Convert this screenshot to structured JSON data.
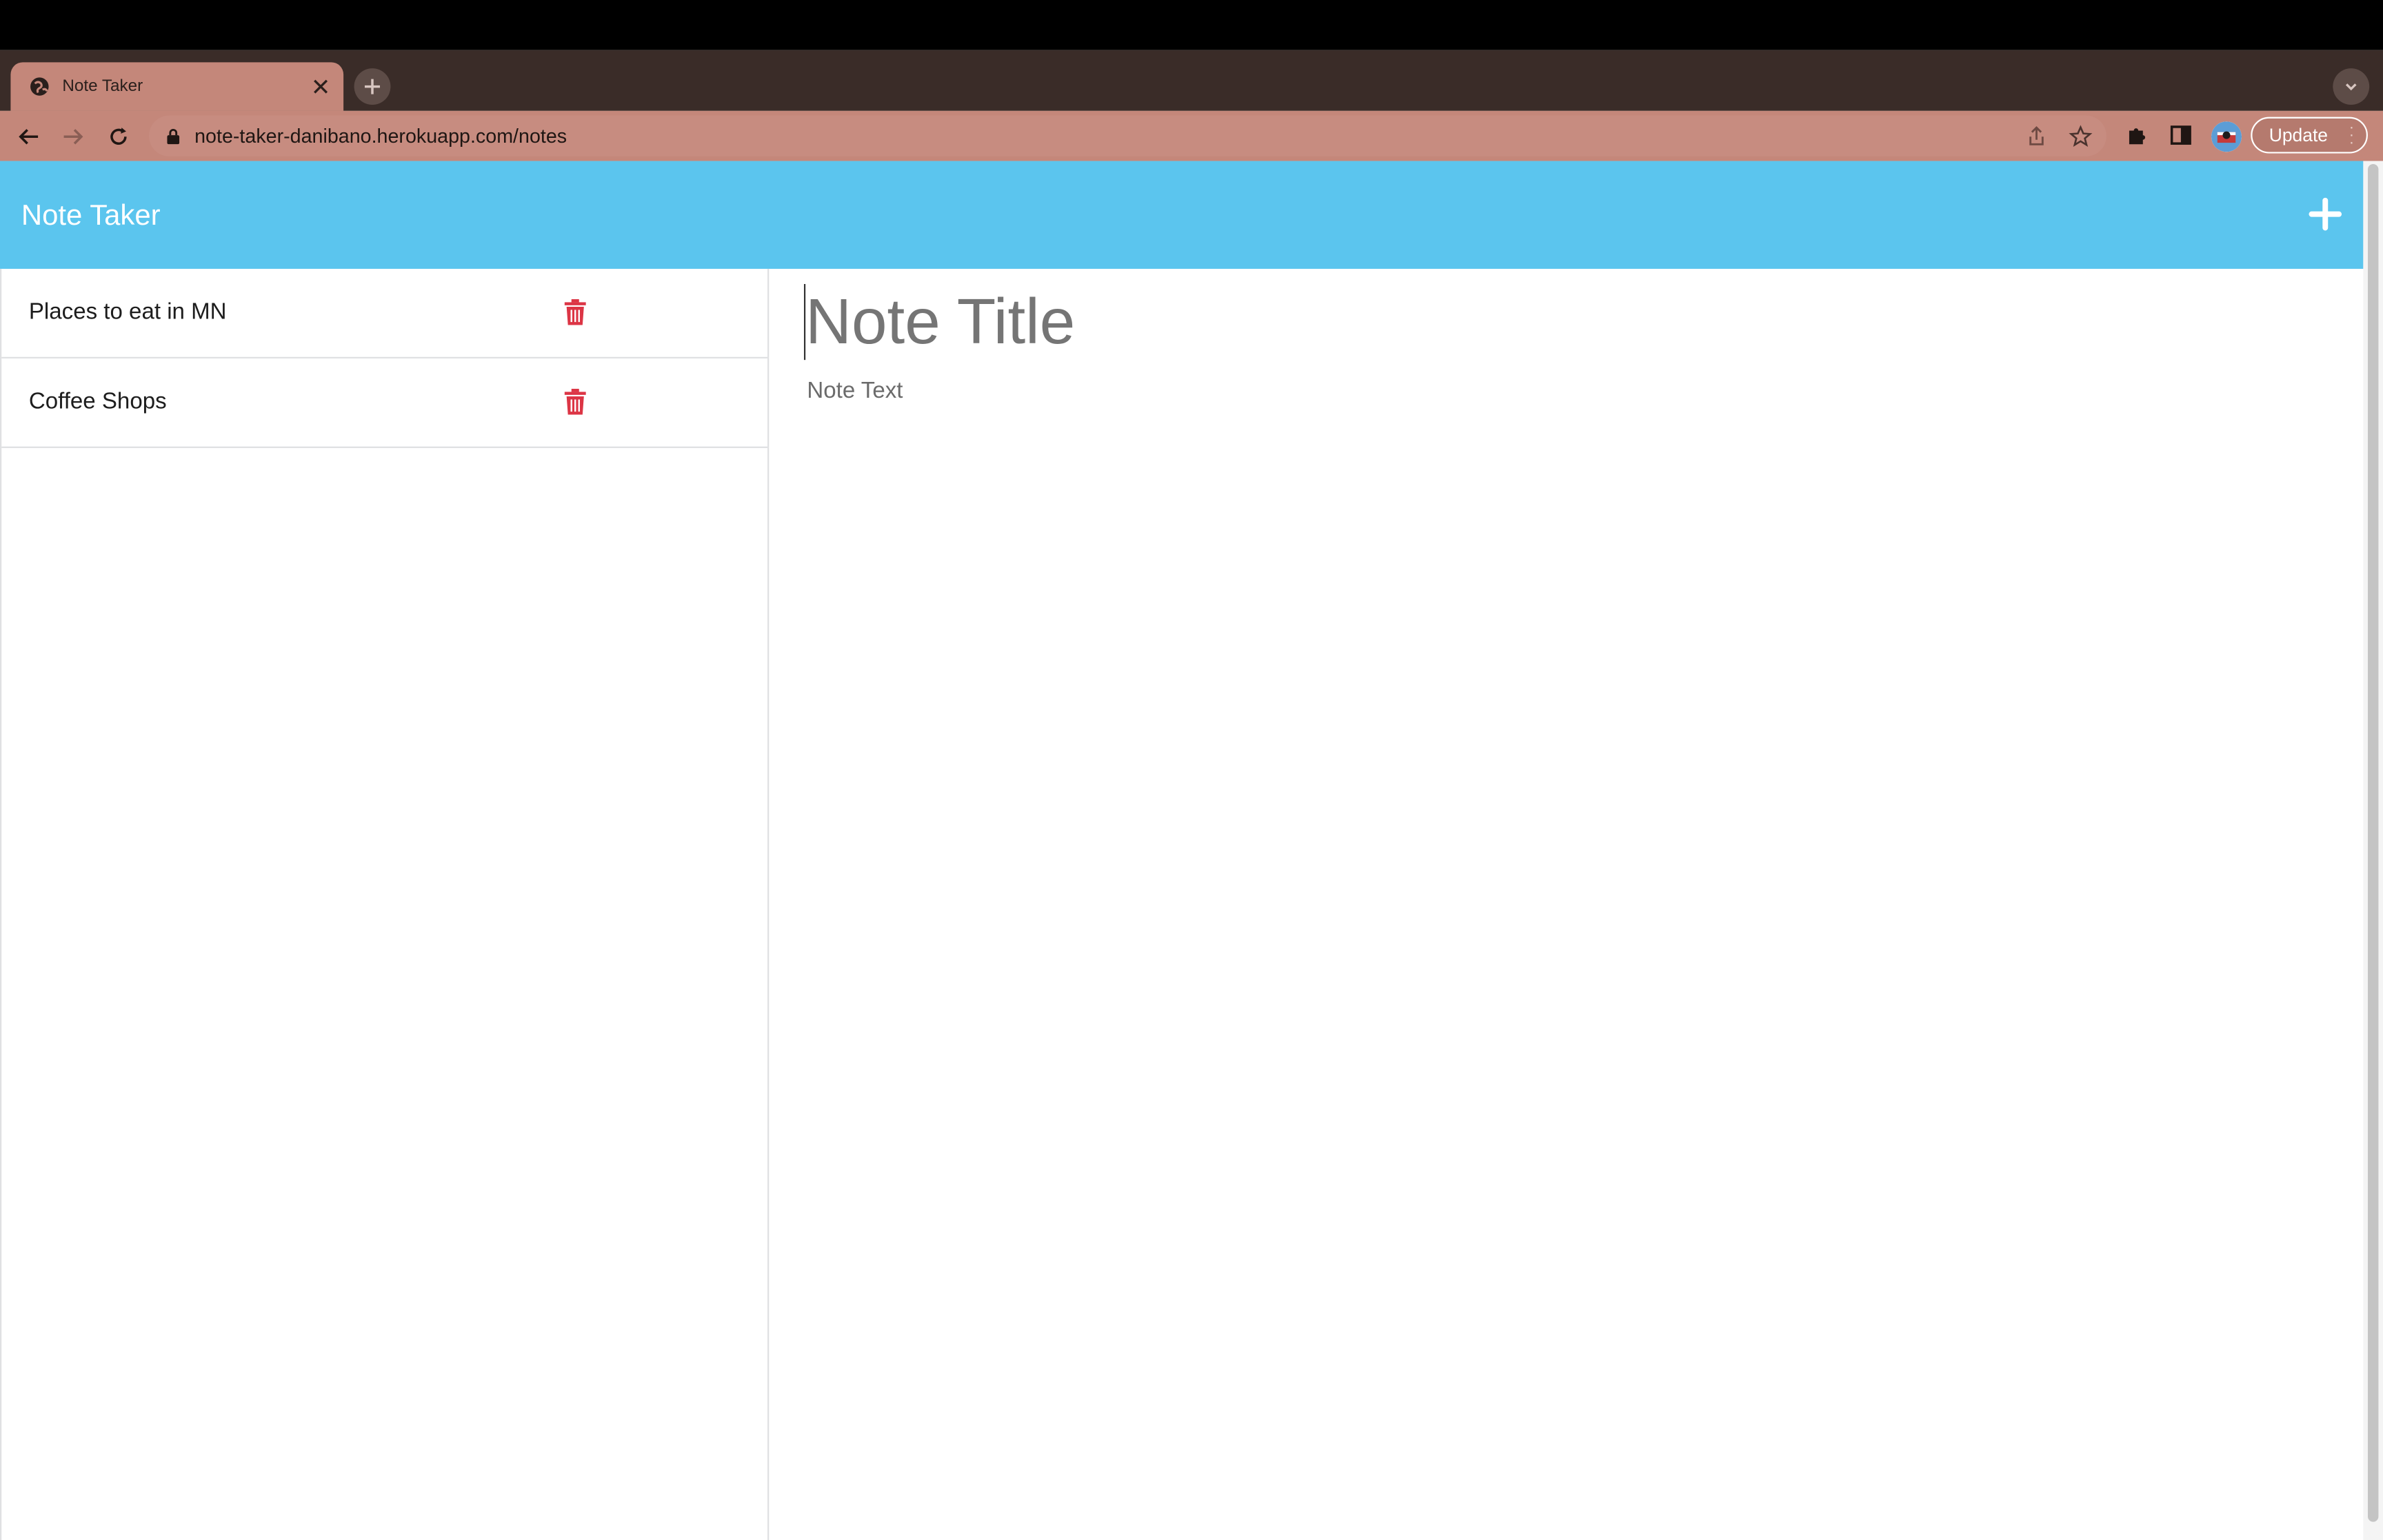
{
  "browser": {
    "tab_title": "Note Taker",
    "url": "note-taker-danibano.herokuapp.com/notes",
    "update_label": "Update",
    "icons": {
      "favicon": "globe-icon",
      "close": "close-icon",
      "new_tab": "plus-icon",
      "tab_search": "chevron-down-icon",
      "back": "arrow-left-icon",
      "forward": "arrow-right-icon",
      "reload": "reload-icon",
      "lock": "lock-icon",
      "share": "share-icon",
      "bookmark": "star-icon",
      "extensions": "puzzle-icon",
      "side_panel": "side-panel-icon",
      "profile": "avatar",
      "menu": "kebab-menu-icon"
    }
  },
  "app": {
    "brand": "Note Taker",
    "new_note_icon": "plus-icon",
    "accent_color": "#5bc5ee",
    "delete_color": "#dc3545"
  },
  "notes": [
    {
      "title": "Places to eat in MN"
    },
    {
      "title": "Coffee Shops"
    }
  ],
  "editor": {
    "title_placeholder": "Note Title",
    "text_placeholder": "Note Text",
    "title_value": "",
    "text_value": ""
  }
}
